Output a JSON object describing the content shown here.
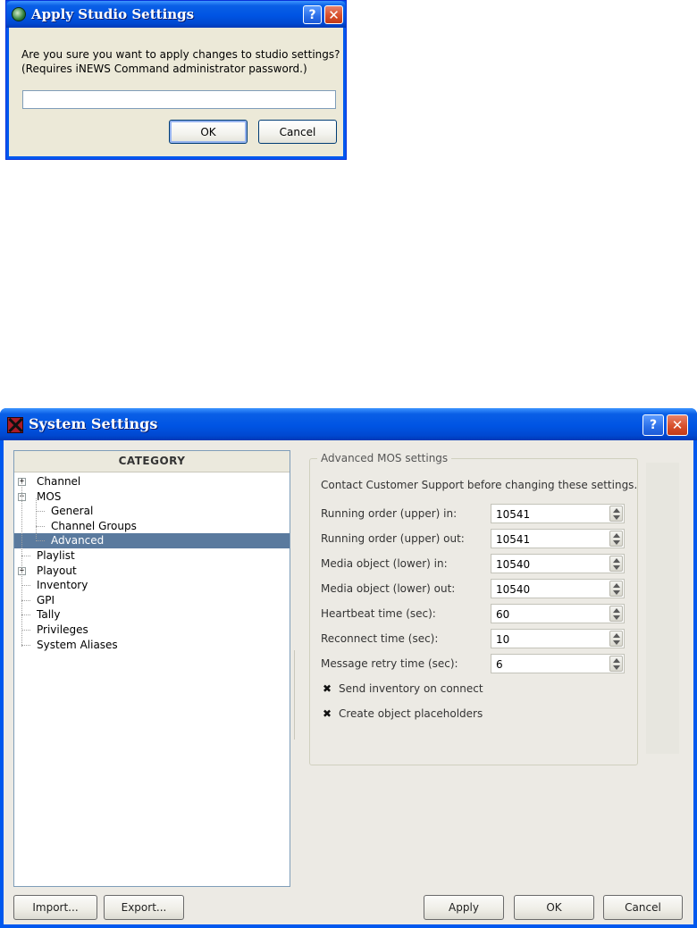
{
  "apply_dialog": {
    "title": "Apply Studio Settings",
    "message_line1": "Are you sure you want to apply changes to studio settings?",
    "message_line2": "(Requires iNEWS Command administrator password.)",
    "password_value": "",
    "ok_label": "OK",
    "cancel_label": "Cancel",
    "icons": [
      "app-globe-icon",
      "help-icon",
      "close-icon"
    ]
  },
  "system_settings": {
    "title": "System Settings",
    "category_header": "CATEGORY",
    "tree": [
      {
        "label": "Channel",
        "level": 0,
        "expander": "+"
      },
      {
        "label": "MOS",
        "level": 0,
        "expander": "-"
      },
      {
        "label": "General",
        "level": 1
      },
      {
        "label": "Channel Groups",
        "level": 1
      },
      {
        "label": "Advanced",
        "level": 1,
        "selected": true
      },
      {
        "label": "Playlist",
        "level": 0
      },
      {
        "label": "Playout",
        "level": 0,
        "expander": "+"
      },
      {
        "label": "Inventory",
        "level": 0
      },
      {
        "label": "GPI",
        "level": 0
      },
      {
        "label": "Tally",
        "level": 0
      },
      {
        "label": "Privileges",
        "level": 0
      },
      {
        "label": "System Aliases",
        "level": 0
      }
    ],
    "advanced": {
      "group_title": "Advanced MOS settings",
      "note": "Contact Customer Support before changing these settings.",
      "fields": [
        {
          "label": "Running order (upper) in:",
          "value": "10541"
        },
        {
          "label": "Running order (upper) out:",
          "value": "10541"
        },
        {
          "label": "Media object (lower) in:",
          "value": "10540"
        },
        {
          "label": "Media object (lower) out:",
          "value": "10540"
        },
        {
          "label": "Heartbeat time (sec):",
          "value": "60"
        },
        {
          "label": "Reconnect time (sec):",
          "value": "10"
        },
        {
          "label": "Message retry time (sec):",
          "value": "6"
        }
      ],
      "checkboxes": [
        {
          "label": "Send inventory on connect",
          "checked": true,
          "mark": "✖"
        },
        {
          "label": "Create object placeholders",
          "checked": true,
          "mark": "✖"
        }
      ]
    },
    "buttons": {
      "import": "Import...",
      "export": "Export...",
      "apply": "Apply",
      "ok": "OK",
      "cancel": "Cancel"
    },
    "help_glyph": "?",
    "close_glyph": "✕"
  }
}
